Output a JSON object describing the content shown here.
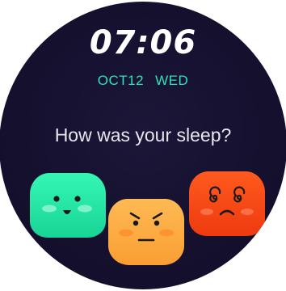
{
  "clock": {
    "time": "07:06",
    "date": "OCT12",
    "weekday": "WED"
  },
  "prompt": {
    "question": "How was your sleep?"
  },
  "moods": [
    {
      "label": "good",
      "icon": "happy-face-icon",
      "color": "#2ff0ad"
    },
    {
      "label": "meh",
      "icon": "annoyed-face-icon",
      "color": "#ffac45"
    },
    {
      "label": "bad",
      "icon": "dizzy-sad-face-icon",
      "color": "#f84a16"
    }
  ],
  "colors": {
    "background": "#15102e",
    "date_accent": "#2de3b7",
    "text": "#ffffff"
  }
}
